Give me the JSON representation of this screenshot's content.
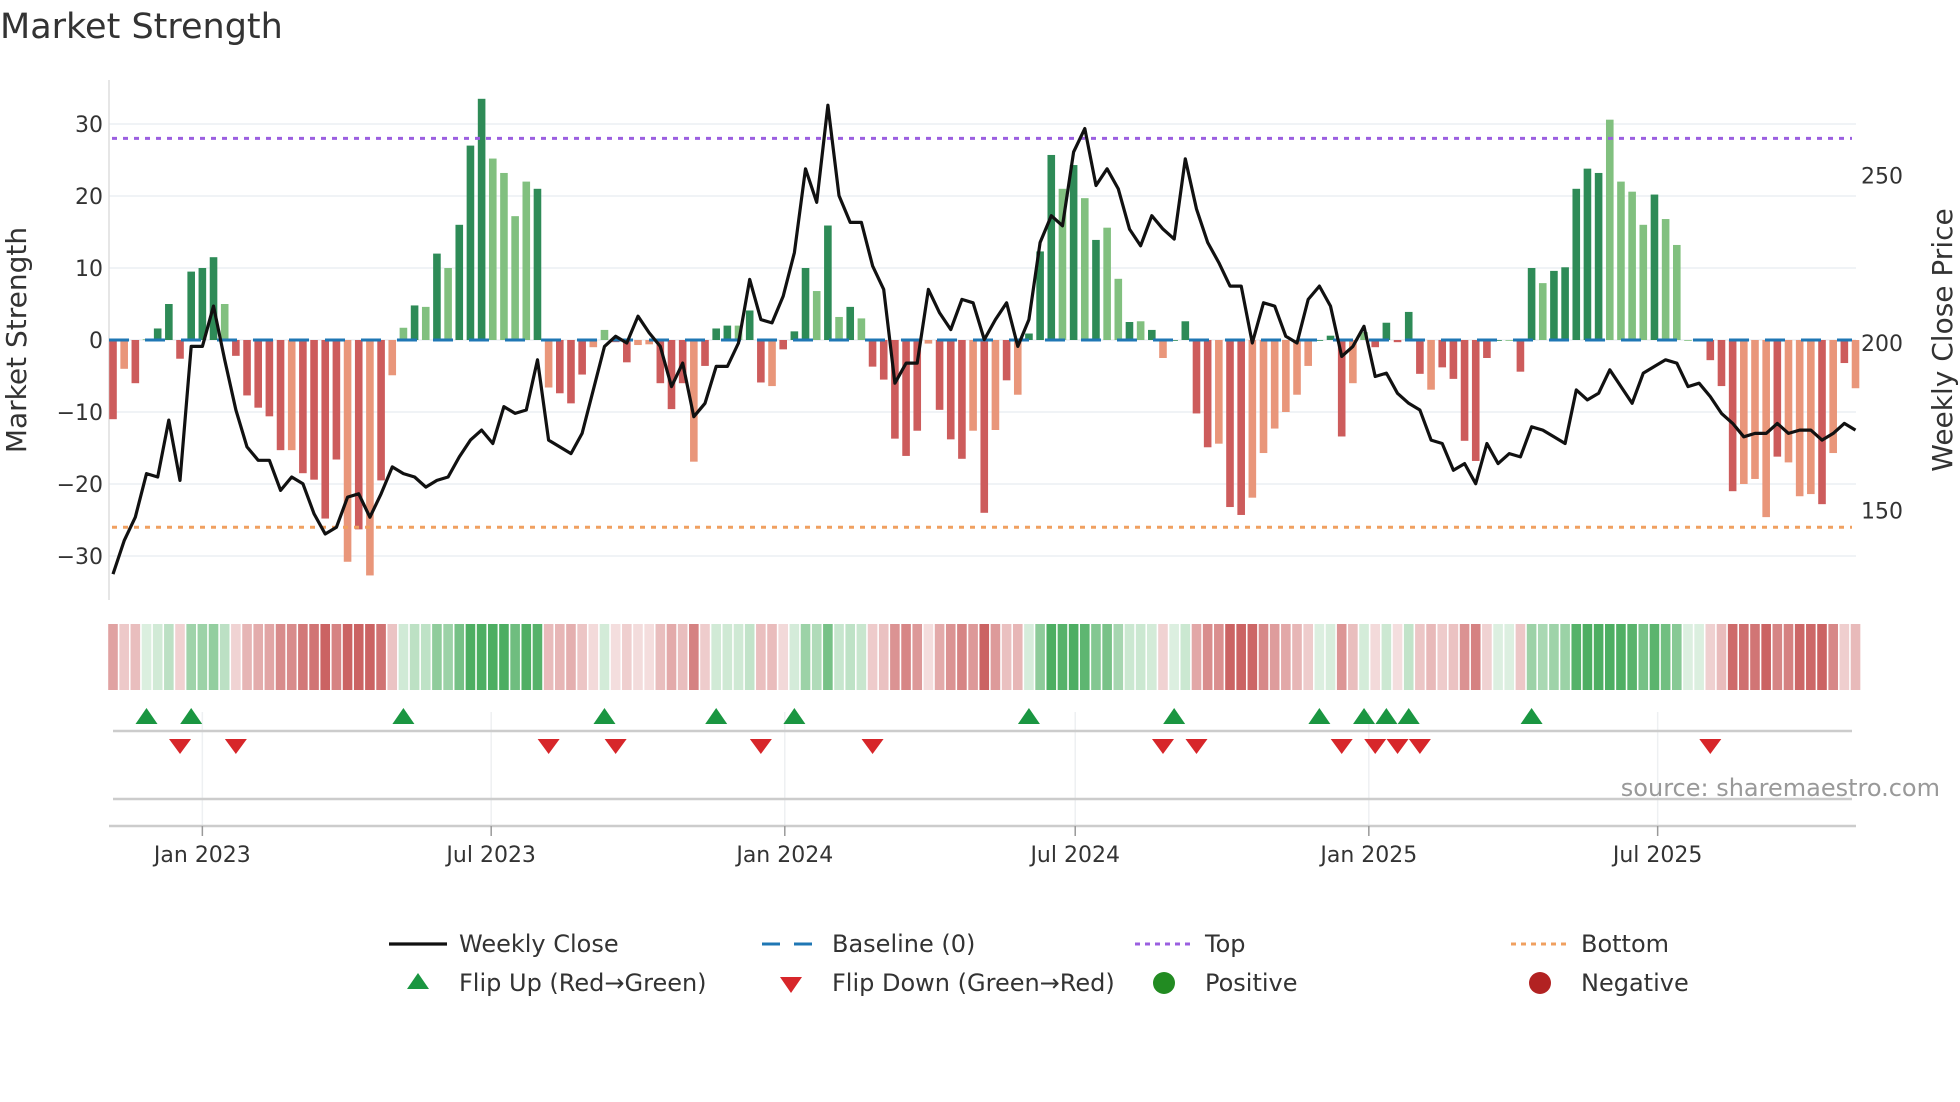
{
  "title": "Market Strength",
  "source": "source: sharemaestro.com",
  "chart_data": {
    "type": "bar",
    "title": "Market Strength",
    "ylabel": "Market Strength",
    "y2label": "Weekly Close Price",
    "ylim": [
      -36,
      37
    ],
    "y2lim": [
      125,
      285
    ],
    "yticks": [
      "30",
      "20",
      "10",
      "0",
      "−10",
      "−20",
      "−30"
    ],
    "ytick_values": [
      30,
      20,
      10,
      0,
      -10,
      -20,
      -30
    ],
    "y2ticks": [
      "250",
      "200",
      "150"
    ],
    "y2tick_values": [
      250,
      200,
      150
    ],
    "x_start": "2022-11-06",
    "x_frequency": "weekly",
    "xticks": [
      {
        "label": "Jan 2023",
        "date": "2023-01-01"
      },
      {
        "label": "Jul 2023",
        "date": "2023-07-01"
      },
      {
        "label": "Jan 2024",
        "date": "2024-01-01"
      },
      {
        "label": "Jul 2024",
        "date": "2024-07-01"
      },
      {
        "label": "Jan 2025",
        "date": "2025-01-01"
      },
      {
        "label": "Jul 2025",
        "date": "2025-07-01"
      }
    ],
    "top_threshold": 28,
    "bottom_threshold": -26,
    "baseline": 0,
    "strength": [
      -11,
      -4,
      -6,
      0.1,
      1.6,
      5,
      -2.6,
      9.5,
      10,
      11.5,
      5,
      -2.2,
      -7.7,
      -9.4,
      -10.6,
      -15.3,
      -15.3,
      -18.5,
      -19.4,
      -24.8,
      -16.6,
      -30.8,
      -26.3,
      -32.7,
      -19.5,
      -4.9,
      1.7,
      4.8,
      4.6,
      12,
      10,
      16,
      27,
      33.5,
      25.2,
      23.2,
      17.2,
      22,
      21,
      -6.6,
      -7.4,
      -8.8,
      -4.8,
      -1,
      1.4,
      -0.3,
      -3.1,
      -0.7,
      -0.6,
      -6,
      -9.6,
      -6,
      -16.9,
      -3.6,
      1.6,
      2,
      2,
      4.1,
      -5.9,
      -6.4,
      -1.3,
      1.2,
      10,
      6.8,
      15.9,
      3.2,
      4.6,
      3,
      -3.7,
      -5.5,
      -13.7,
      -16.1,
      -12.6,
      -0.5,
      -9.7,
      -13.8,
      -16.5,
      -12.6,
      -24,
      -12.5,
      -5.6,
      -7.6,
      0.9,
      12.3,
      25.7,
      21,
      24.3,
      19.7,
      13.9,
      15.6,
      8.5,
      2.5,
      2.6,
      1.4,
      -2.5,
      0,
      2.6,
      -10.2,
      -14.9,
      -14.4,
      -23.2,
      -24.3,
      -21.9,
      -15.7,
      -12.3,
      -10,
      -7.6,
      -3.6,
      0,
      0.6,
      -13.4,
      -6,
      1.1,
      -1,
      2.4,
      -0.3,
      3.9,
      -4.7,
      -6.9,
      -3.8,
      -5.4,
      -14,
      -16.8,
      -2.5,
      0,
      0,
      -4.4,
      10,
      7.9,
      9.6,
      10.1,
      21,
      23.8,
      23.2,
      30.6,
      22,
      20.6,
      16,
      20.2,
      16.8,
      13.2,
      0,
      0.1,
      -2.8,
      -6.4,
      -21,
      -20,
      -19.3,
      -24.6,
      -16.2,
      -17,
      -21.7,
      -21.4,
      -22.8,
      -15.7,
      -3.2,
      -6.7
    ],
    "shade": "dldlddddddldddddlddddldldlldldldddlllldldddllddlldddldddlddldddldldldddddldddldldldddldldlldldlddddlddlllllldddlldddddlddddddlddldddddlllldlllddddllldllldldldldlld",
    "weekly_close": [
      131,
      141,
      148,
      161,
      160,
      177,
      159,
      199,
      199,
      211,
      195,
      180,
      169,
      165,
      165,
      156,
      160,
      158,
      149,
      143,
      145,
      154,
      155,
      148,
      155,
      163,
      161,
      160,
      157,
      159,
      160,
      166,
      171,
      174,
      170,
      181,
      179,
      180,
      195,
      171,
      169,
      167,
      173,
      186,
      199,
      202,
      200,
      208,
      203,
      199,
      187,
      194,
      178,
      182,
      193,
      193,
      200,
      219,
      207,
      206,
      214,
      227,
      252,
      242,
      271,
      244,
      236,
      236,
      223,
      216,
      188,
      194,
      194,
      216,
      209,
      204,
      213,
      212,
      201,
      207,
      212,
      199,
      207,
      230,
      238,
      235,
      257,
      264,
      247,
      252,
      246,
      234,
      229,
      238,
      234,
      231,
      255,
      240,
      230,
      224,
      217,
      217,
      200,
      212,
      211,
      202,
      200,
      213,
      217,
      211,
      196,
      199,
      205,
      190,
      191,
      185,
      182,
      180,
      171,
      170,
      162,
      164,
      158,
      170,
      164,
      167,
      166,
      175,
      174,
      172,
      170,
      186,
      183,
      185,
      192,
      187,
      182,
      191,
      193,
      195,
      194,
      187,
      188,
      184,
      179,
      176,
      172,
      173,
      173,
      176,
      173,
      174,
      174,
      171,
      173,
      176,
      174
    ],
    "flip_up_weeks": [
      3,
      7,
      26,
      44,
      54,
      61,
      82,
      95,
      108,
      112,
      114,
      116,
      127
    ],
    "flip_down_weeks": [
      6,
      11,
      39,
      45,
      58,
      68,
      94,
      97,
      110,
      113,
      115,
      117,
      143
    ],
    "colors": {
      "positive_dark": "#2e8b57",
      "positive_light": "#81c07f",
      "negative_dark": "#cd5c5c",
      "negative_light": "#e9967a",
      "line": "#111111",
      "baseline": "#1f77b4",
      "top": "#9b5fe0",
      "bottom": "#f0a060",
      "flip_up": "#1a9641",
      "flip_down": "#d7262a",
      "positive_marker": "#228b22",
      "negative_marker": "#b22222"
    },
    "legend": [
      {
        "label": "Weekly Close",
        "symbol": "line"
      },
      {
        "label": "Baseline (0)",
        "symbol": "dash"
      },
      {
        "label": "Top",
        "symbol": "dot-purple"
      },
      {
        "label": "Bottom",
        "symbol": "dot-orange"
      },
      {
        "label": "Flip Up (Red→Green)",
        "symbol": "triangle-up"
      },
      {
        "label": "Flip Down (Green→Red)",
        "symbol": "triangle-down"
      },
      {
        "label": "Positive",
        "symbol": "circle-green"
      },
      {
        "label": "Negative",
        "symbol": "circle-red"
      }
    ],
    "legend_position": "bottom"
  }
}
